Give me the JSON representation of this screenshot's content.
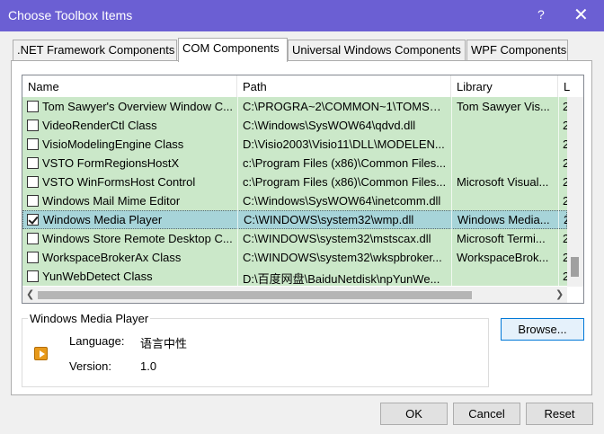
{
  "window": {
    "title": "Choose Toolbox Items",
    "help": "?",
    "close": "✕"
  },
  "tabs": [
    {
      "label": ".NET Framework Components"
    },
    {
      "label": "COM Components"
    },
    {
      "label": "Universal Windows Components"
    },
    {
      "label": "WPF Components"
    }
  ],
  "list": {
    "columns": [
      "Name",
      "Path",
      "Library",
      "L"
    ],
    "rows": [
      {
        "checked": false,
        "name": "Tom Sawyer's Overview Window C...",
        "path": "C:\\PROGRA~2\\COMMON~1\\TOMSA...",
        "library": "Tom Sawyer Vis...",
        "ver": "2"
      },
      {
        "checked": false,
        "name": "VideoRenderCtl Class",
        "path": "C:\\Windows\\SysWOW64\\qdvd.dll",
        "library": "",
        "ver": "2"
      },
      {
        "checked": false,
        "name": "VisioModelingEngine Class",
        "path": "D:\\Visio2003\\Visio11\\DLL\\MODELEN...",
        "library": "",
        "ver": "2"
      },
      {
        "checked": false,
        "name": "VSTO FormRegionsHostX",
        "path": "c:\\Program Files (x86)\\Common Files...",
        "library": "",
        "ver": "2"
      },
      {
        "checked": false,
        "name": "VSTO WinFormsHost Control",
        "path": "c:\\Program Files (x86)\\Common Files...",
        "library": "Microsoft Visual...",
        "ver": "2"
      },
      {
        "checked": false,
        "name": "Windows Mail Mime Editor",
        "path": "C:\\Windows\\SysWOW64\\inetcomm.dll",
        "library": "",
        "ver": "2"
      },
      {
        "checked": true,
        "name": "Windows Media Player",
        "path": "C:\\WINDOWS\\system32\\wmp.dll",
        "library": "Windows Media...",
        "ver": "2"
      },
      {
        "checked": false,
        "name": "Windows Store Remote Desktop C...",
        "path": "C:\\WINDOWS\\system32\\mstscax.dll",
        "library": "Microsoft Termi...",
        "ver": "2"
      },
      {
        "checked": false,
        "name": "WorkspaceBrokerAx Class",
        "path": "C:\\WINDOWS\\system32\\wkspbroker...",
        "library": "WorkspaceBrok...",
        "ver": "2"
      },
      {
        "checked": false,
        "name": "YunWebDetect Class",
        "path": "D:\\百度网盘\\BaiduNetdisk\\npYunWe...",
        "library": "",
        "ver": "2"
      }
    ],
    "selected_index": 6
  },
  "details": {
    "group_title": "Windows Media Player",
    "language_label": "Language:",
    "language_value": "语言中性",
    "version_label": "Version:",
    "version_value": "1.0",
    "icon": "windows-media-player-icon"
  },
  "buttons": {
    "browse": "Browse...",
    "ok": "OK",
    "cancel": "Cancel",
    "reset": "Reset"
  },
  "colors": {
    "titlebar": "#6b5fd3",
    "row_background": "#cbe8c9",
    "selected_row": "#a7d4d9",
    "browse_border": "#0078d7"
  }
}
